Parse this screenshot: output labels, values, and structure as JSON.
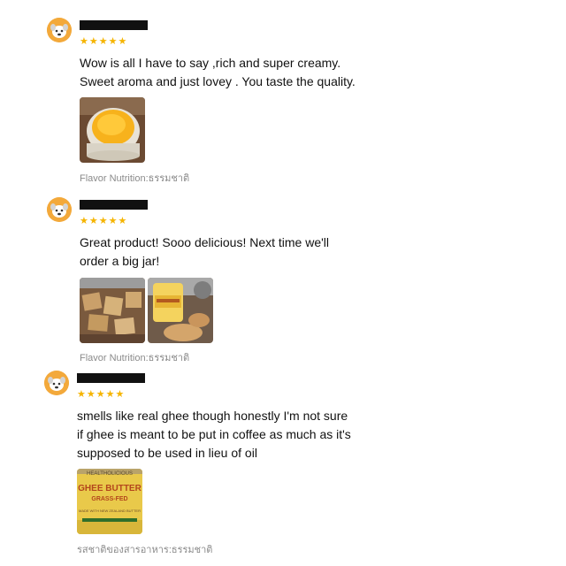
{
  "reviews": [
    {
      "stars": "★★★★★",
      "text": "Wow is all I have to say ,rich and super creamy.\nSweet aroma and just lovey . You taste the quality.",
      "variant": "Flavor Nutrition:ธรรมชาติ"
    },
    {
      "stars": "★★★★★",
      "text": "Great product! Sooo delicious! Next time we'll\norder a big jar!",
      "variant": "Flavor Nutrition:ธรรมชาติ"
    },
    {
      "stars": "★★★★★",
      "text": "smells like real ghee though honestly I'm not sure\nif ghee is meant to be put in coffee as much as it's\nsupposed to be used in lieu of oil",
      "variant": "รสชาติของสารอาหาร:ธรรมชาติ",
      "photo_label_top": "HEALTHOLICIOUS",
      "photo_label_main": "GHEE BUTTER",
      "photo_label_sub": "GRASS-FED",
      "photo_label_small": "MADE WITH NEW ZEALAND BUTTER"
    }
  ],
  "colors": {
    "star": "#f5b400",
    "avatar": "#f3a93b",
    "variant_text": "#8a8a8a"
  }
}
